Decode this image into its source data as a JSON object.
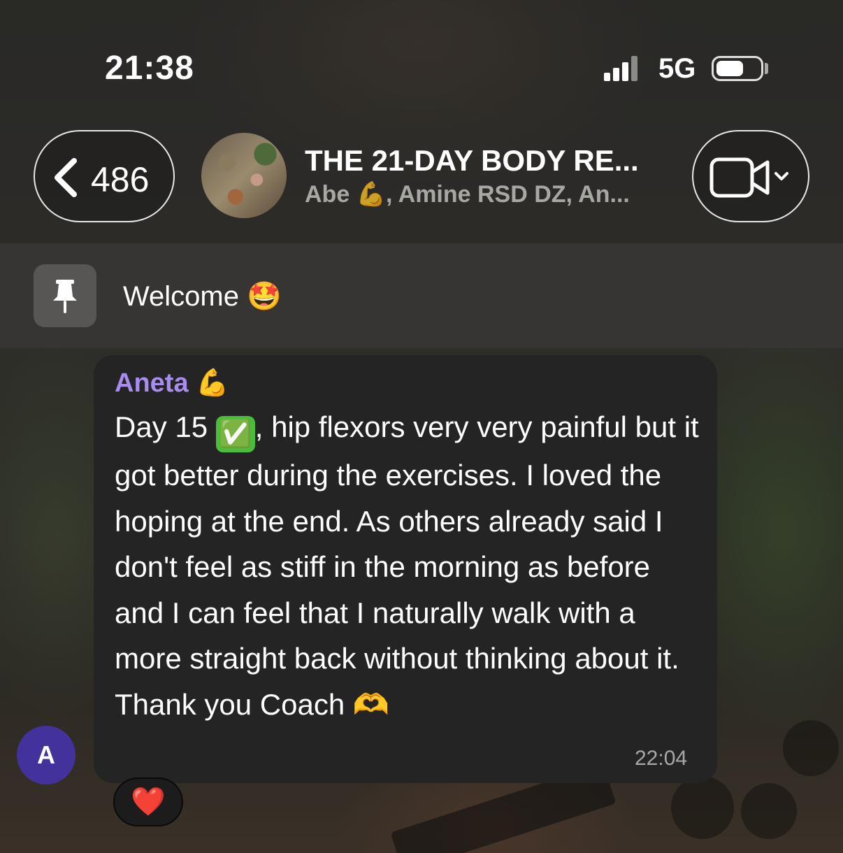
{
  "status_bar": {
    "time": "21:38",
    "network": "5G"
  },
  "header": {
    "back_count": "486",
    "group_title": "THE 21-DAY BODY RE...",
    "group_members": "Abe 💪, Amine RSD DZ, An..."
  },
  "pinned": {
    "text": "Welcome 🤩"
  },
  "message": {
    "sender": "Aneta 💪",
    "text_before_check": "Day 15 ",
    "check_emoji": "✅",
    "text_after_check": ", hip flexors very very painful but it got better during the exercises. I loved the hoping at the end. As others already said I don't feel as stiff in the morning as before and I can feel that I naturally walk with a more straight back without thinking about it. Thank you Coach 🫶",
    "time": "22:04",
    "avatar_initial": "A",
    "reaction": "❤️"
  },
  "colors": {
    "sender_name": "#a88cf0",
    "avatar_bg": "#43329c",
    "bubble_bg": "#242424",
    "check_green": "#4bbd3a"
  }
}
